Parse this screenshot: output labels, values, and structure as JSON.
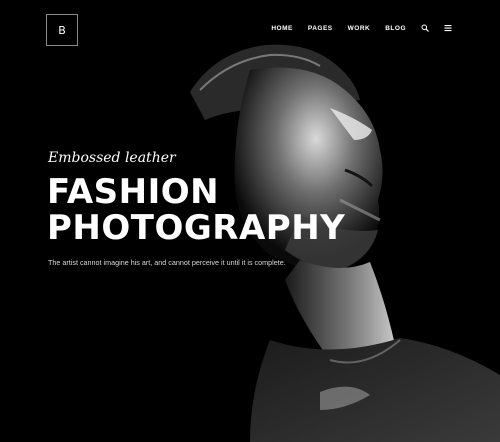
{
  "logo": {
    "letter": "B"
  },
  "nav": {
    "items": [
      {
        "label": "HOME"
      },
      {
        "label": "PAGES"
      },
      {
        "label": "WORK"
      },
      {
        "label": "BLOG"
      }
    ],
    "icons": [
      "search-icon",
      "menu-icon"
    ]
  },
  "hero": {
    "tagline": "Embossed leather",
    "title_line1": "FASHION",
    "title_line2": "PHOTOGRAPHY",
    "subtitle": "The artist cannot imagine his art, and cannot perceive it until it is complete."
  },
  "colors": {
    "background": "#000000",
    "text": "#ffffff",
    "subtext": "#d8d8d8"
  }
}
